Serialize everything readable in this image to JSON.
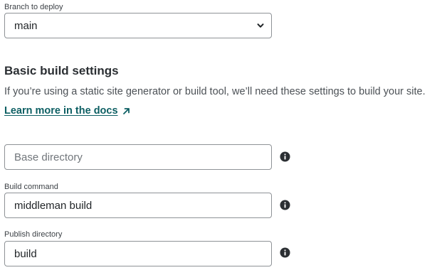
{
  "branch": {
    "label": "Branch to deploy",
    "selected": "main"
  },
  "build_settings": {
    "heading": "Basic build settings",
    "description": "If you’re using a static site generator or build tool, we’ll need these settings to build your site.",
    "docs_link": "Learn more in the docs"
  },
  "base_directory": {
    "placeholder": "Base directory",
    "value": ""
  },
  "build_command": {
    "label": "Build command",
    "value": "middleman build"
  },
  "publish_directory": {
    "label": "Publish directory",
    "value": "build"
  },
  "icons": {
    "info": "info-icon",
    "chevron": "chevron-down-icon",
    "external": "arrow-up-right-icon"
  },
  "colors": {
    "link": "#0d5f63",
    "border": "#8e9296",
    "icon": "#2b2f33"
  }
}
